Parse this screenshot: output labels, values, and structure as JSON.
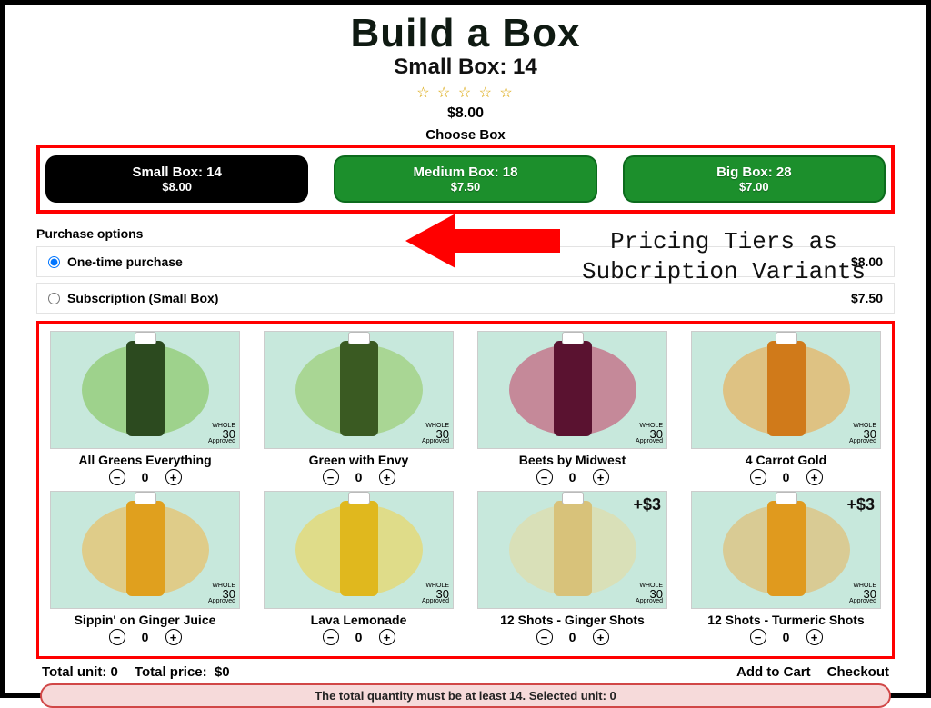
{
  "header": {
    "title": "Build a Box",
    "subtitle": "Small Box: 14",
    "rating_stars": "☆ ☆ ☆ ☆ ☆",
    "price": "$8.00",
    "choose_label": "Choose Box"
  },
  "tiers": [
    {
      "label": "Small Box: 14",
      "price": "$8.00",
      "active": true
    },
    {
      "label": "Medium Box: 18",
      "price": "$7.50",
      "active": false
    },
    {
      "label": "Big Box: 28",
      "price": "$7.00",
      "active": false
    }
  ],
  "annotation": {
    "line1": "Pricing Tiers as",
    "line2": "Subcription Variants"
  },
  "purchase": {
    "heading": "Purchase options",
    "options": [
      {
        "label": "One-time purchase",
        "price": "$8.00",
        "selected": true
      },
      {
        "label": "Subscription (Small Box)",
        "price": "$7.50",
        "selected": false
      }
    ]
  },
  "products": [
    {
      "name": "All Greens Everything",
      "qty": "0",
      "surcharge": "",
      "bottle": "#2c4a1f",
      "splash": "#7cbf4a"
    },
    {
      "name": "Green with Envy",
      "qty": "0",
      "surcharge": "",
      "bottle": "#3a5a22",
      "splash": "#8fc75a"
    },
    {
      "name": "Beets by Midwest",
      "qty": "0",
      "surcharge": "",
      "bottle": "#5a1230",
      "splash": "#c23a62"
    },
    {
      "name": "4 Carrot Gold",
      "qty": "0",
      "surcharge": "",
      "bottle": "#d07a1a",
      "splash": "#f0a23a"
    },
    {
      "name": "Sippin' on Ginger Juice",
      "qty": "0",
      "surcharge": "",
      "bottle": "#e0a01e",
      "splash": "#f2b445"
    },
    {
      "name": "Lava Lemonade",
      "qty": "0",
      "surcharge": "",
      "bottle": "#e0b81e",
      "splash": "#f2d245"
    },
    {
      "name": "12 Shots - Ginger Shots",
      "qty": "0",
      "surcharge": "+$3",
      "bottle": "#d8c27a",
      "splash": "#e8d89a"
    },
    {
      "name": "12 Shots - Turmeric Shots",
      "qty": "0",
      "surcharge": "+$3",
      "bottle": "#e09a1e",
      "splash": "#e8b25a"
    }
  ],
  "footer": {
    "total_unit_label": "Total unit:",
    "total_unit_value": "0",
    "total_price_label": "Total price:",
    "total_price_value": "$0",
    "add_to_cart": "Add to Cart",
    "checkout": "Checkout"
  },
  "alert": "The total quantity must be at least 14. Selected unit: 0",
  "badge30": {
    "top": "WHOLE",
    "mid": "30",
    "bot": "Approved"
  }
}
